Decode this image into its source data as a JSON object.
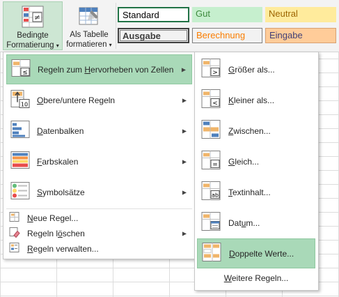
{
  "ribbon": {
    "cond_format": {
      "line1": "Bedingte",
      "line2": "Formatierung",
      "dropdown": "▾"
    },
    "as_table": {
      "line1": "Als Tabelle",
      "line2": "formatieren",
      "dropdown": "▾"
    },
    "styles": [
      {
        "id": "standard",
        "label": "Standard"
      },
      {
        "id": "gut",
        "label": "Gut"
      },
      {
        "id": "neutral",
        "label": "Neutral"
      },
      {
        "id": "ausgabe",
        "label": "Ausgabe"
      },
      {
        "id": "berechnung",
        "label": "Berechnung"
      },
      {
        "id": "eingabe",
        "label": "Eingabe"
      }
    ]
  },
  "menu": {
    "items": [
      {
        "pre": "Regeln zum ",
        "key": "H",
        "post": "ervorheben von Zellen",
        "arrow": "▶",
        "icon": "highlight-cells-rules-icon"
      },
      {
        "pre": "",
        "key": "O",
        "post": "bere/untere Regeln",
        "arrow": "▶",
        "icon": "top-bottom-rules-icon"
      },
      {
        "pre": "",
        "key": "D",
        "post": "atenbalken",
        "arrow": "▶",
        "icon": "data-bars-icon"
      },
      {
        "pre": "",
        "key": "F",
        "post": "arbskalen",
        "arrow": "▶",
        "icon": "color-scales-icon"
      },
      {
        "pre": "",
        "key": "S",
        "post": "ymbolsätze",
        "arrow": "▶",
        "icon": "icon-sets-icon"
      }
    ],
    "small_items": [
      {
        "pre": "",
        "key": "N",
        "post": "eue Regel...",
        "arrow": "",
        "icon": "new-rule-icon"
      },
      {
        "pre": "Regeln l",
        "key": "ö",
        "post": "schen",
        "arrow": "▶",
        "icon": "clear-rules-icon"
      },
      {
        "pre": "",
        "key": "R",
        "post": "egeln verwalten...",
        "arrow": "",
        "icon": "manage-rules-icon"
      }
    ]
  },
  "submenu": {
    "items": [
      {
        "pre": "",
        "key": "G",
        "post": "rößer als...",
        "icon": "greater-than-icon"
      },
      {
        "pre": "",
        "key": "K",
        "post": "leiner als...",
        "icon": "less-than-icon"
      },
      {
        "pre": "",
        "key": "Z",
        "post": "wischen...",
        "icon": "between-icon"
      },
      {
        "pre": "",
        "key": "G",
        "post": "leich...",
        "icon": "equal-to-icon"
      },
      {
        "pre": "",
        "key": "T",
        "post": "extinhalt...",
        "icon": "text-contains-icon"
      },
      {
        "pre": "Dat",
        "key": "u",
        "post": "m...",
        "icon": "date-occurring-icon"
      },
      {
        "pre": "",
        "key": "D",
        "post": "oppelte Werte...",
        "icon": "duplicate-values-icon"
      }
    ],
    "more": {
      "pre": "",
      "key": "W",
      "post": "eitere Regeln..."
    }
  }
}
